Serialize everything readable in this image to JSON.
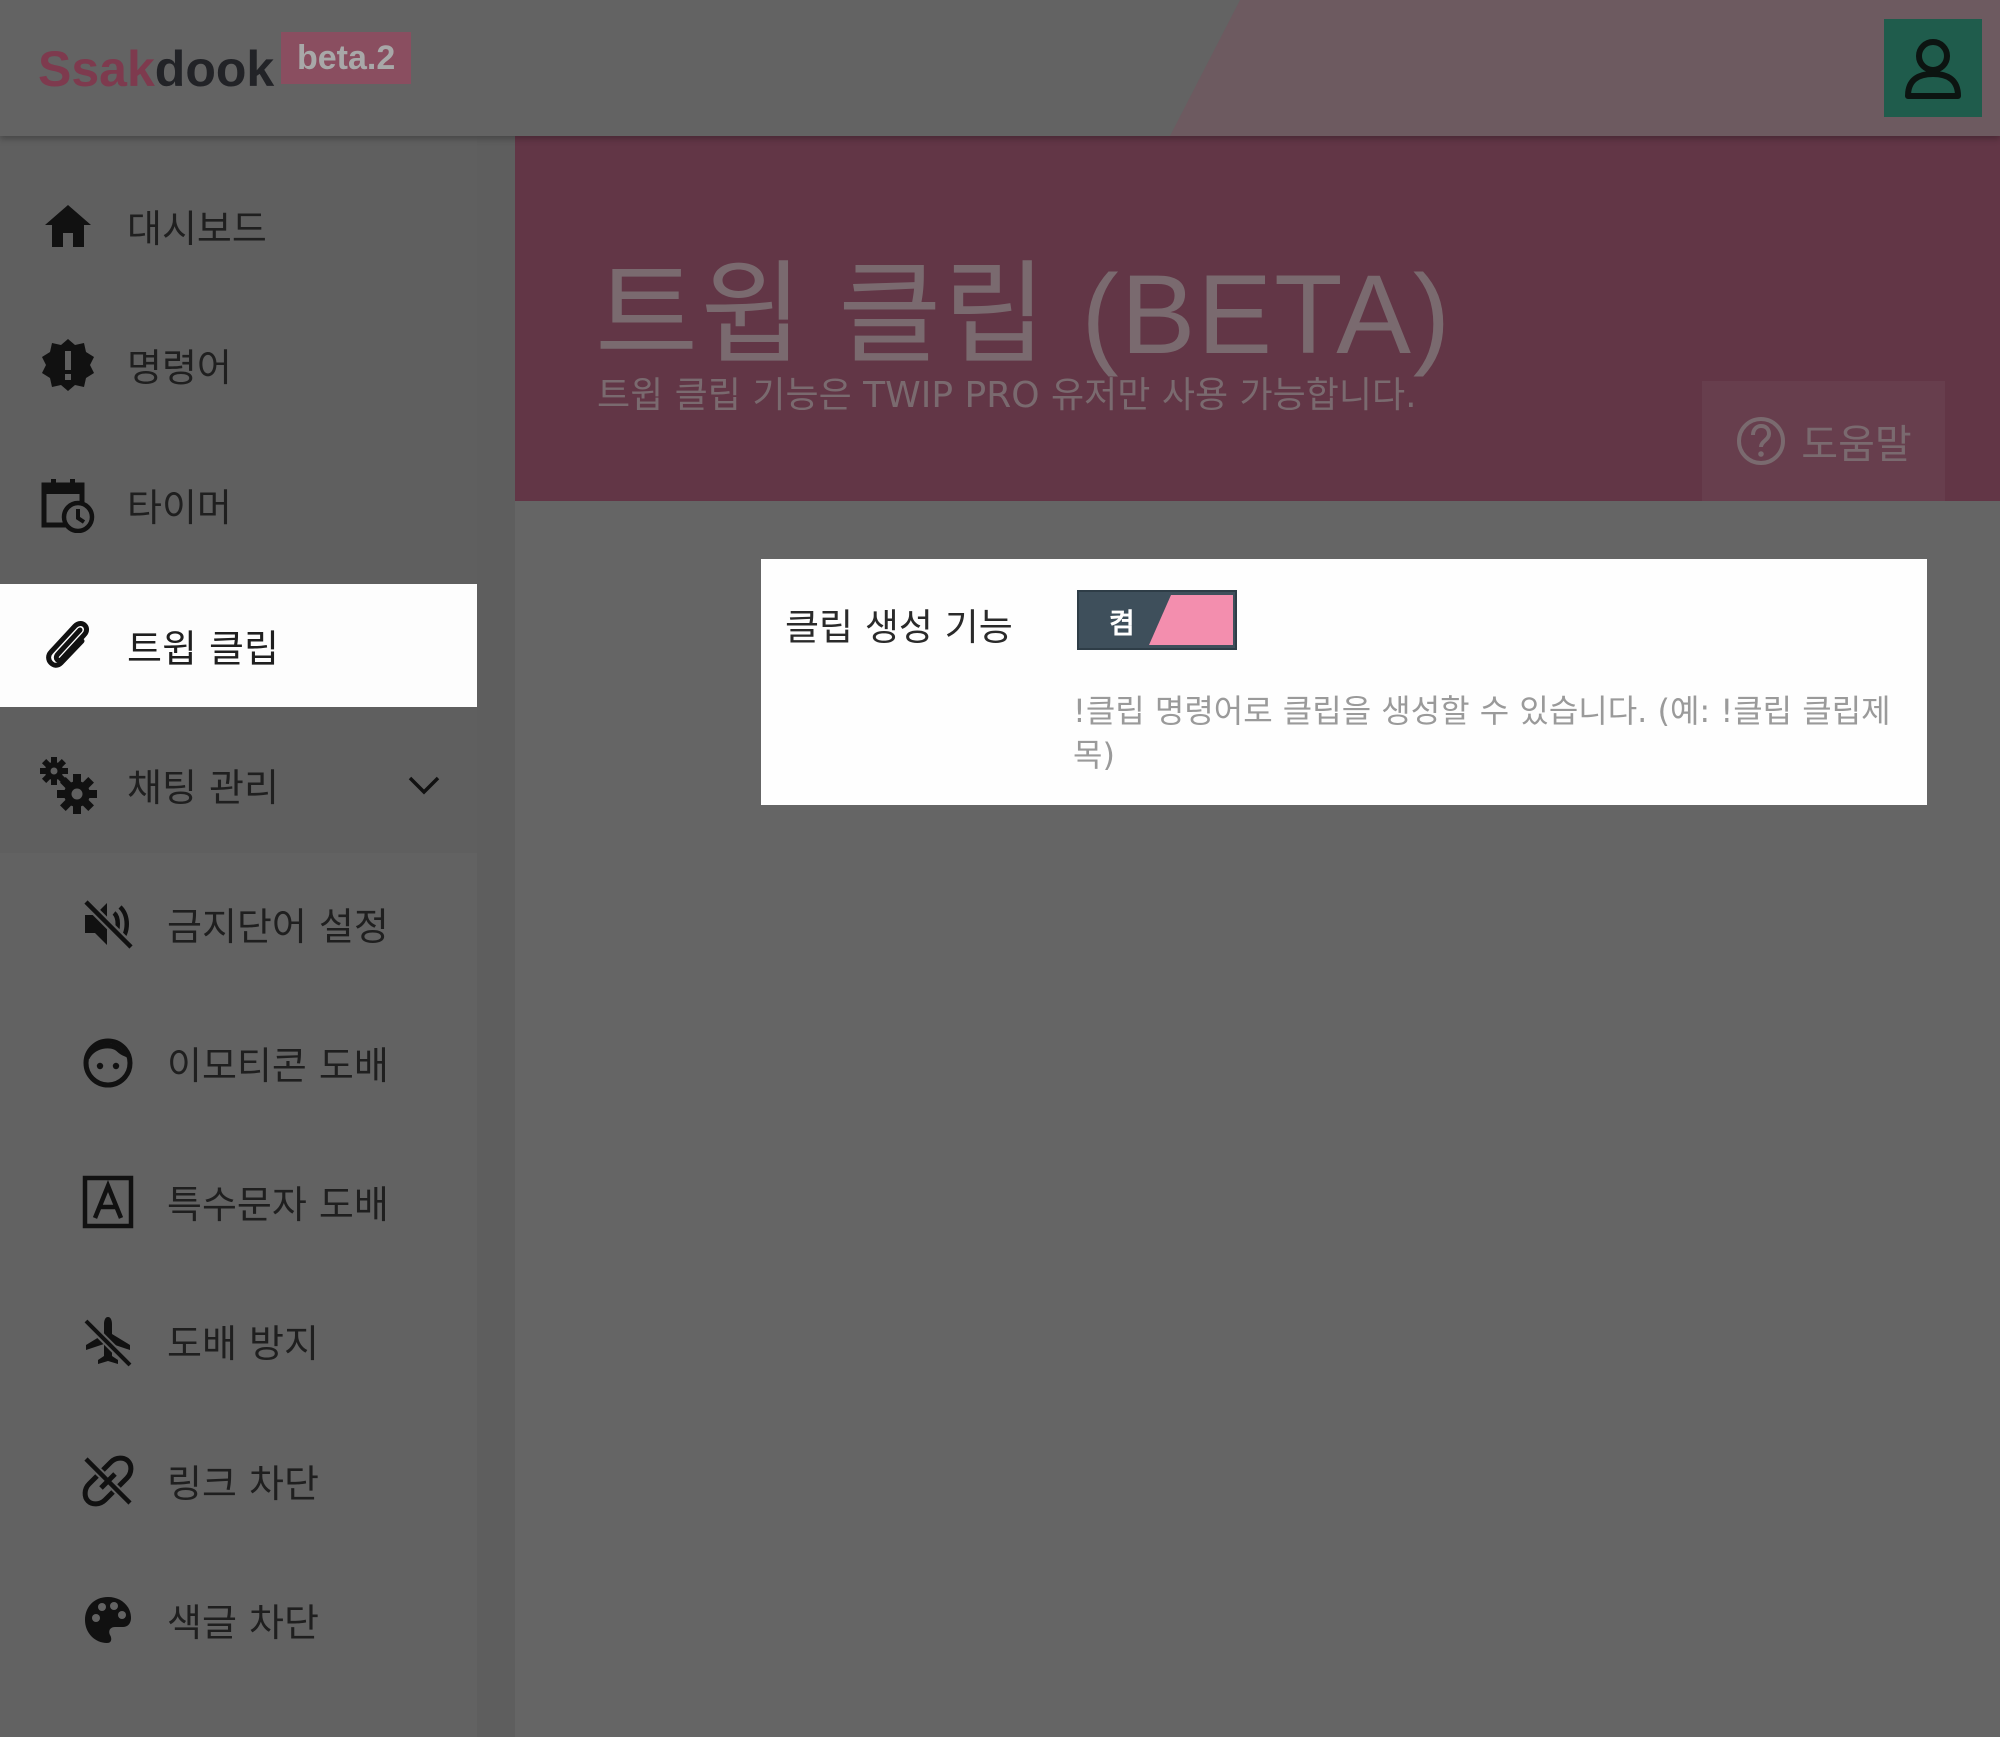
{
  "header": {
    "logo_part1": "Ssak",
    "logo_part2": "dook",
    "beta_badge": "beta.2",
    "user_icon": "user-icon"
  },
  "sidebar": {
    "items": [
      {
        "label": "대시보드",
        "icon": "home-icon"
      },
      {
        "label": "명령어",
        "icon": "alert-badge-icon"
      },
      {
        "label": "타이머",
        "icon": "calendar-clock-icon"
      },
      {
        "label": "트윕 클립",
        "icon": "paperclip-icon",
        "active": true
      },
      {
        "label": "채팅 관리",
        "icon": "gears-icon",
        "expanded": true
      },
      {
        "label": "금지단어 설정",
        "icon": "volume-off-icon"
      },
      {
        "label": "이모티콘 도배",
        "icon": "face-icon"
      },
      {
        "label": "특수문자 도배",
        "icon": "letter-a-box-icon"
      },
      {
        "label": "도배 방지",
        "icon": "airplane-off-icon"
      },
      {
        "label": "링크 차단",
        "icon": "link-off-icon"
      },
      {
        "label": "색글 차단",
        "icon": "palette-icon"
      }
    ]
  },
  "hero": {
    "title": "트윕 클립 (BETA)",
    "subtitle": "트윕 클립 기능은 TWIP PRO 유저만 사용 가능합니다.",
    "help_label": "도움말"
  },
  "card": {
    "label": "클립 생성 기능",
    "toggle_text": "켬",
    "toggle_on": true,
    "description": "!클립 명령어로 클립을 생성할 수 있습니다. (예: !클립 클립제목)"
  },
  "colors": {
    "accent": "#f38eae",
    "hero_bg": "#623646",
    "user_button": "#1f5c4c",
    "toggle_bg": "#3e4f5b"
  }
}
